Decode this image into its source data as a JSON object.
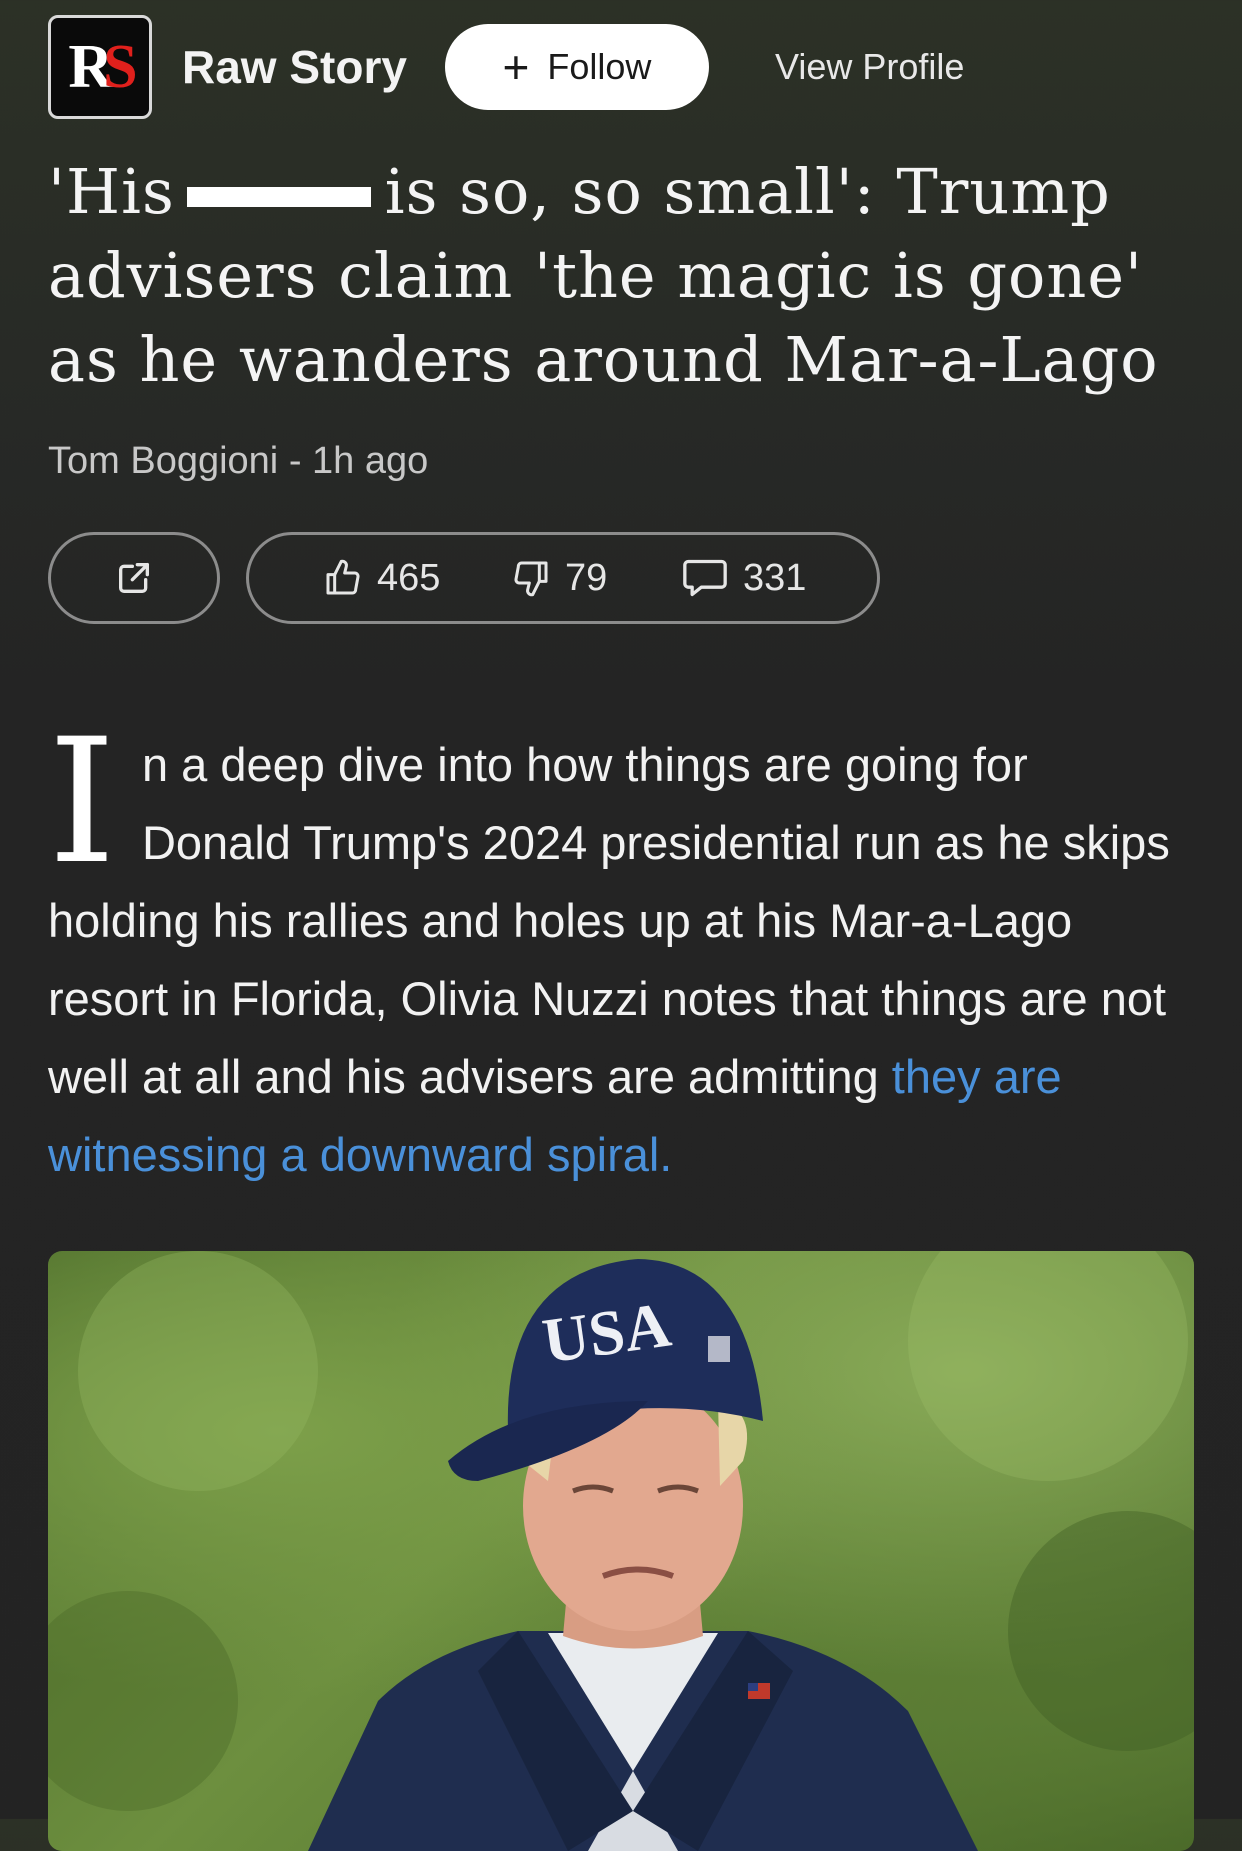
{
  "header": {
    "logo_text": "RS",
    "publisher": "Raw Story",
    "follow_label": "Follow",
    "view_profile_label": "View Profile"
  },
  "article": {
    "title_part1": "'His",
    "title_part2": "is so, so small': Trump advisers claim 'the magic is gone' as he wanders around Mar-a-Lago",
    "author": "Tom Boggioni",
    "separator": "-",
    "time_ago": "1h ago",
    "dropcap": "I",
    "body_text": "n a deep dive into how things are going for Donald Trump's 2024 presidential run as he skips holding his rallies and holes up at his Mar-a-Lago resort in Florida, Olivia Nuzzi notes that things are not well at all and his advisers are admitting ",
    "body_link": "they are witnessing a downward spiral.",
    "photo": {
      "cap_text": "USA"
    }
  },
  "actions": {
    "likes": "465",
    "dislikes": "79",
    "comments": "331"
  },
  "colors": {
    "link": "#4a90d9",
    "logo_red": "#e0201c"
  },
  "icons": [
    "share-icon",
    "thumbs-up-icon",
    "thumbs-down-icon",
    "comment-icon",
    "plus-icon"
  ]
}
